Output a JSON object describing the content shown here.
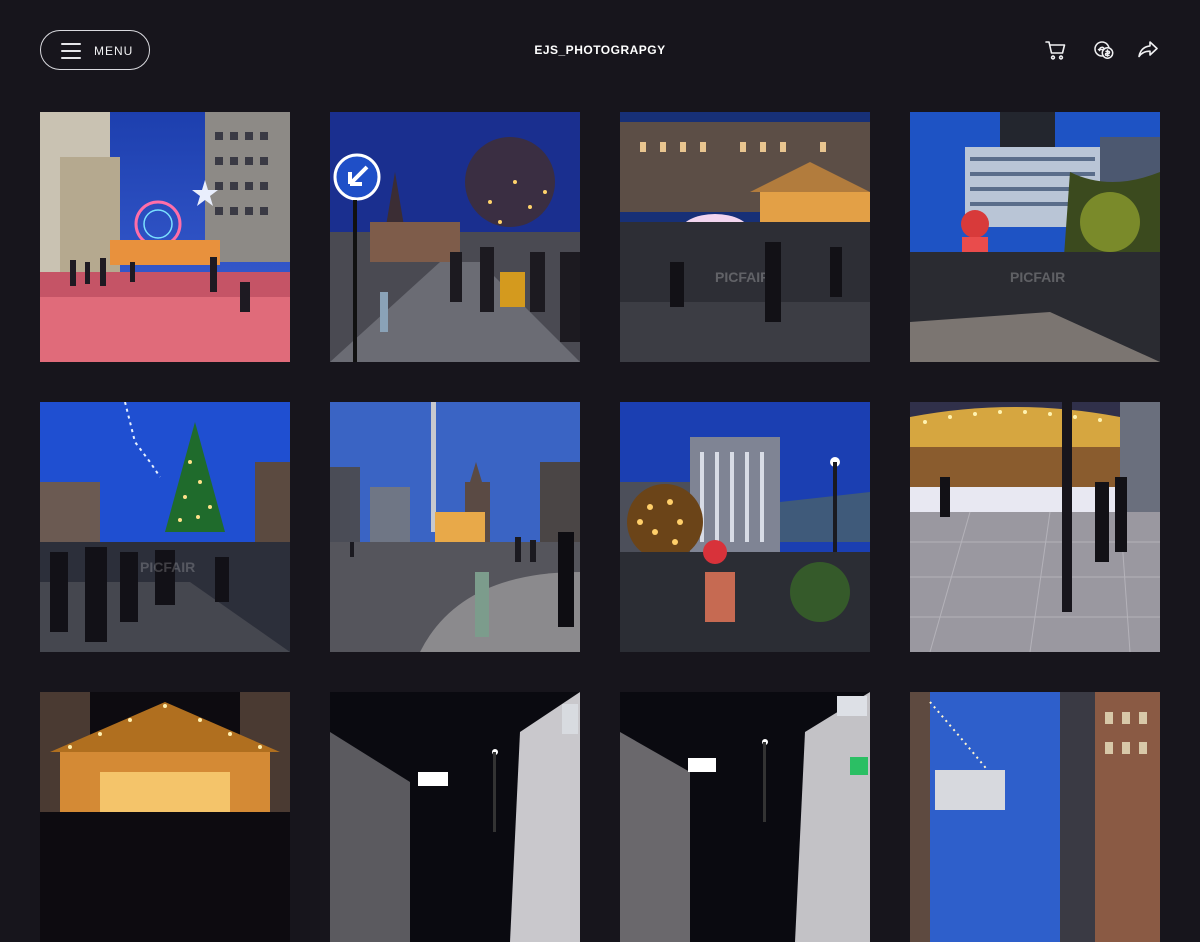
{
  "header": {
    "menu_label": "MENU",
    "site_title": "EJS_PHOTOGRAPGY",
    "icons": [
      "cart-icon",
      "currency-icon",
      "share-icon"
    ]
  },
  "colors": {
    "background": "#17151c",
    "text": "#ffffff",
    "button_border": "#d9d9de"
  },
  "gallery": {
    "photos": [
      {
        "scene": "street-ferris-wheel",
        "watermark": ""
      },
      {
        "scene": "street-sign-tree",
        "watermark": ""
      },
      {
        "scene": "market-square-night",
        "watermark": "PICFAIR"
      },
      {
        "scene": "tower-block-bear",
        "watermark": "PICFAIR"
      },
      {
        "scene": "christmas-tree-crowd",
        "watermark": "PICFAIR"
      },
      {
        "scene": "monument-plaza",
        "watermark": ""
      },
      {
        "scene": "lit-trees-building",
        "watermark": ""
      },
      {
        "scene": "carousel",
        "watermark": ""
      },
      {
        "scene": "market-hut",
        "watermark": ""
      },
      {
        "scene": "shopping-street",
        "watermark": ""
      },
      {
        "scene": "shopping-street-2",
        "watermark": ""
      },
      {
        "scene": "brick-street-dusk",
        "watermark": ""
      }
    ]
  }
}
